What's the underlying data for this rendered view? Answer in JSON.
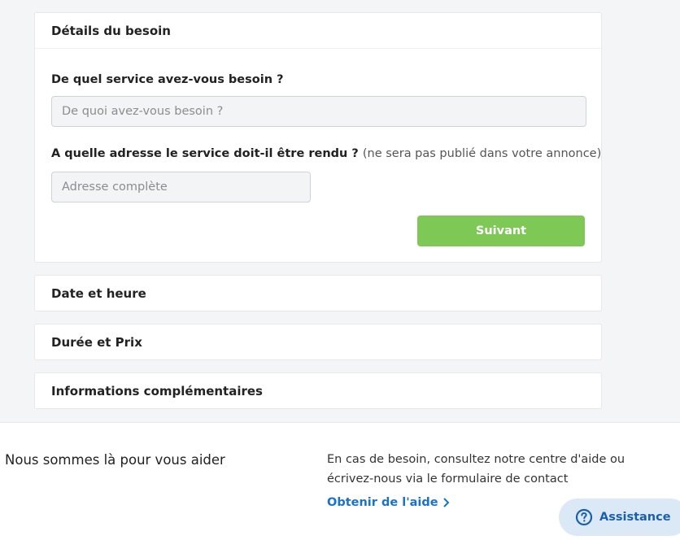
{
  "sections": {
    "details": {
      "title": "Détails du besoin",
      "service_label": "De quel service avez-vous besoin ?",
      "service_placeholder": "De quoi avez-vous besoin ?",
      "address_label": "A quelle adresse le service doit-il être rendu ?",
      "address_note": "(ne sera pas publié dans votre annonce)",
      "address_placeholder": "Adresse complète",
      "next_label": "Suivant"
    },
    "date_time": {
      "title": "Date et heure"
    },
    "duration_price": {
      "title": "Durée et Prix"
    },
    "extra_info": {
      "title": "Informations complémentaires"
    }
  },
  "footer": {
    "title": "Nous sommes là pour vous aider",
    "text_line1": "En cas de besoin, consultez notre centre d'aide ou",
    "text_line2": "écrivez-nous via le formulaire de contact",
    "help_link": "Obtenir de l'aide"
  },
  "assistance": {
    "label": "Assistance",
    "icon": "question-circle-icon"
  },
  "colors": {
    "accent_green": "#7ec856",
    "link_blue": "#1a73c8",
    "assistance_bg": "#dbe9f6",
    "page_bg": "#f4f5f7"
  }
}
